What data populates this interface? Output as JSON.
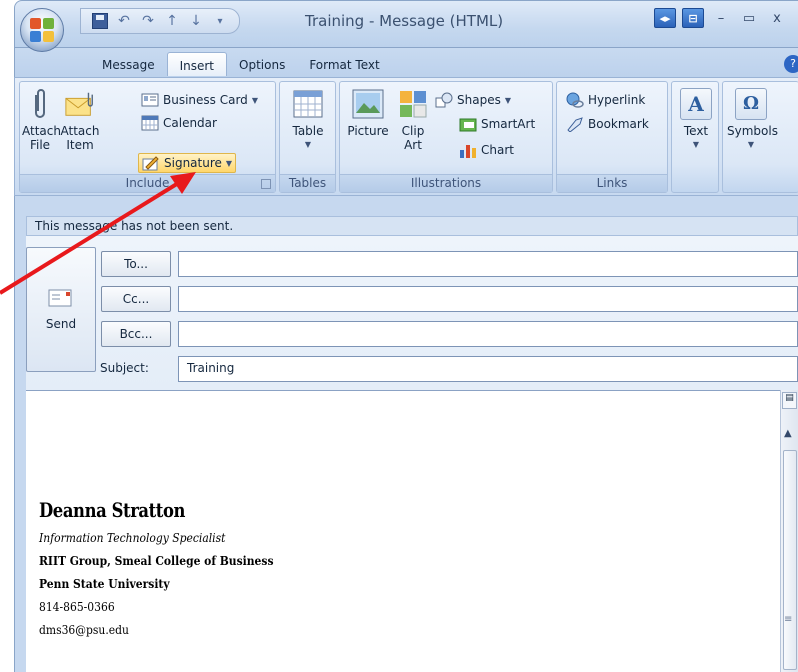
{
  "window": {
    "title": "Training - Message (HTML)",
    "controls": {
      "minimize": "–",
      "maximize": "▭",
      "close": "x"
    }
  },
  "ribbon_tabs": [
    "Message",
    "Insert",
    "Options",
    "Format Text"
  ],
  "active_tab": "Insert",
  "groups": {
    "include": {
      "label": "Include",
      "attach_file": [
        "Attach",
        "File"
      ],
      "attach_item": [
        "Attach",
        "Item"
      ],
      "business_card": "Business Card",
      "calendar": "Calendar",
      "signature": "Signature"
    },
    "tables": {
      "label": "Tables",
      "table": "Table"
    },
    "illustrations": {
      "label": "Illustrations",
      "picture": "Picture",
      "clip_art": [
        "Clip",
        "Art"
      ],
      "shapes": "Shapes",
      "smartart": "SmartArt",
      "chart": "Chart"
    },
    "links": {
      "label": "Links",
      "hyperlink": "Hyperlink",
      "bookmark": "Bookmark"
    },
    "text": {
      "label": "Text"
    },
    "symbols": {
      "label": "Symbols"
    }
  },
  "info_bar": "This message has not been sent.",
  "compose": {
    "send": "Send",
    "to": "To...",
    "cc": "Cc...",
    "bcc": "Bcc...",
    "subject_label": "Subject:",
    "subject_value": "Training",
    "to_value": "",
    "cc_value": "",
    "bcc_value": ""
  },
  "signature": {
    "name": "Deanna Stratton",
    "title": "Information Technology Specialist",
    "org": "RIIT Group, Smeal College of Business",
    "university": "Penn State University",
    "phone": "814-865-0366",
    "email": "dms36@psu.edu"
  },
  "colors": {
    "annotation_arrow": "#e8191c",
    "ribbon_bg": "#d4e2f4",
    "signature_highlight": "#ffd66b"
  }
}
